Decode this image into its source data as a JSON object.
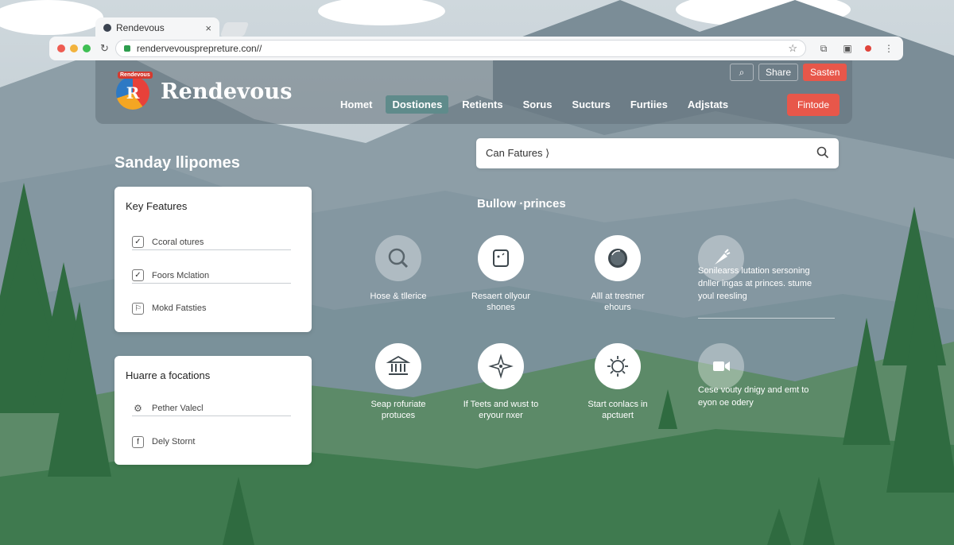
{
  "browser": {
    "tab_title": "Rendevous",
    "tab_close": "×",
    "url": "rendervevousprepreture.con//",
    "star": "☆"
  },
  "header": {
    "logo_badge": "Rendevous",
    "logo_letter": "R",
    "brand": "Rendevous",
    "top_actions": {
      "search_icon": "⌕",
      "share": "Share",
      "primary": "Sasten"
    },
    "nav": [
      "Homet",
      "Dostiones",
      "Retients",
      "Sorus",
      "Sucturs",
      "Furtiies",
      "Adjstats"
    ],
    "nav_active": "Dostiones",
    "cta": "Fintode"
  },
  "left": {
    "title": "Sanday llipomes",
    "card1": {
      "heading": "Key Features",
      "items": [
        {
          "label": "Ccoral otures",
          "icon": "checkbox-checked-icon"
        },
        {
          "label": "Foors Mclation",
          "icon": "checkbox-checked-icon"
        },
        {
          "label": "Mokd Fatsties",
          "icon": "flag-box-icon"
        }
      ]
    },
    "card2": {
      "heading": "Huarre a focations",
      "items": [
        {
          "label": "Pether Valecl",
          "icon": "gear-icon"
        },
        {
          "label": "Dely Stornt",
          "icon": "facebook-icon"
        }
      ]
    }
  },
  "right": {
    "search_value": "Can Fatures ⟩",
    "section_title": "Bullow ·princes",
    "features_row1": [
      {
        "label": "Hose & tllerice",
        "icon": "search-icon"
      },
      {
        "label": "Resaert ollyour\nshones",
        "icon": "tablet-icon"
      },
      {
        "label": "Alll at trestner\nehours",
        "icon": "circle-icon"
      }
    ],
    "side_feature_1": {
      "icon": "carrot-icon",
      "text": "Sonilearss lutation sersoning\ndnller ingas at princes. stume\nyoul reesling"
    },
    "features_row2": [
      {
        "label": "Seap rofuriate\nprotuces",
        "icon": "bank-icon"
      },
      {
        "label": "If Teets and wust to\neryour nxer",
        "icon": "star-flower-icon"
      },
      {
        "label": "Start conlacs in\napctuert",
        "icon": "gear-sun-icon"
      }
    ],
    "side_feature_2": {
      "icon": "video-icon",
      "text": "Cese vouty dnigy and emt to\neyon oe odery"
    }
  }
}
